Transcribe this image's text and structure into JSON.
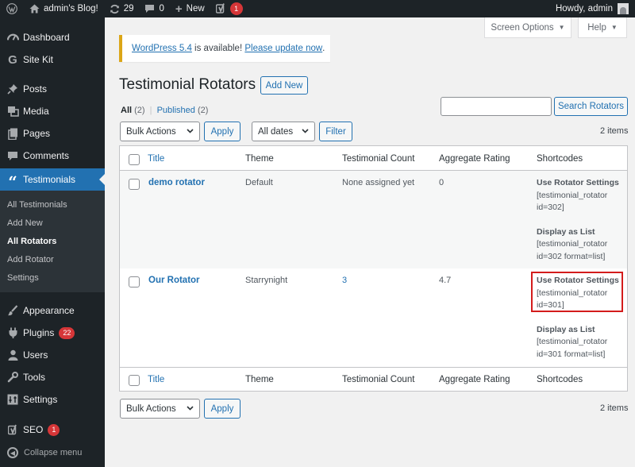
{
  "admin_bar": {
    "site_name": "admin's Blog!",
    "updates_count": "29",
    "comments_count": "0",
    "new_label": "New",
    "seo_count": "1",
    "howdy": "Howdy, admin"
  },
  "sidebar": {
    "items": [
      {
        "label": "Dashboard",
        "icon": "dashboard-icon"
      },
      {
        "label": "Site Kit",
        "icon": "site-kit-icon"
      },
      {
        "label": "Posts",
        "icon": "pin-icon"
      },
      {
        "label": "Media",
        "icon": "media-icon"
      },
      {
        "label": "Pages",
        "icon": "pages-icon"
      },
      {
        "label": "Comments",
        "icon": "comment-icon"
      },
      {
        "label": "Testimonials",
        "icon": "quote-icon"
      },
      {
        "label": "Appearance",
        "icon": "brush-icon"
      },
      {
        "label": "Plugins",
        "icon": "plugin-icon",
        "badge": "22"
      },
      {
        "label": "Users",
        "icon": "user-icon"
      },
      {
        "label": "Tools",
        "icon": "wrench-icon"
      },
      {
        "label": "Settings",
        "icon": "settings-icon"
      },
      {
        "label": "SEO",
        "icon": "yoast-icon",
        "badge": "1"
      }
    ],
    "submenu": [
      "All Testimonials",
      "Add New",
      "All Rotators",
      "Add Rotator",
      "Settings"
    ],
    "collapse_label": "Collapse menu"
  },
  "screen_meta": {
    "screen_options": "Screen Options",
    "help": "Help"
  },
  "notice": {
    "version_link": "WordPress 5.4",
    "text": " is available! ",
    "update_link": "Please update now",
    "period": "."
  },
  "page": {
    "title": "Testimonial Rotators",
    "add_new": "Add New",
    "views": {
      "all": "All",
      "all_count": "(2)",
      "sep": "|",
      "published": "Published",
      "published_count": "(2)"
    },
    "search_button": "Search Rotators",
    "bulk_actions": "Bulk Actions",
    "apply": "Apply",
    "all_dates": "All dates",
    "filter": "Filter",
    "items_count": "2 items"
  },
  "table": {
    "columns": [
      "Title",
      "Theme",
      "Testimonial Count",
      "Aggregate Rating",
      "Shortcodes"
    ],
    "rows": [
      {
        "title": "demo rotator",
        "theme": "Default",
        "count": "None assigned yet",
        "rating": "0",
        "sc_settings_label": "Use Rotator Settings",
        "sc_settings_code": "[testimonial_rotator id=302]",
        "sc_list_label": "Display as List",
        "sc_list_code": "[testimonial_rotator id=302 format=list]"
      },
      {
        "title": "Our Rotator",
        "theme": "Starrynight",
        "count": "3",
        "rating": "4.7",
        "sc_settings_label": "Use Rotator Settings",
        "sc_settings_code": "[testimonial_rotator id=301]",
        "sc_list_label": "Display as List",
        "sc_list_code": "[testimonial_rotator id=301 format=list]"
      }
    ]
  },
  "colors": {
    "accent": "#2271b1",
    "sidebar_bg": "#1d2327",
    "highlight": "#d31c1c"
  }
}
